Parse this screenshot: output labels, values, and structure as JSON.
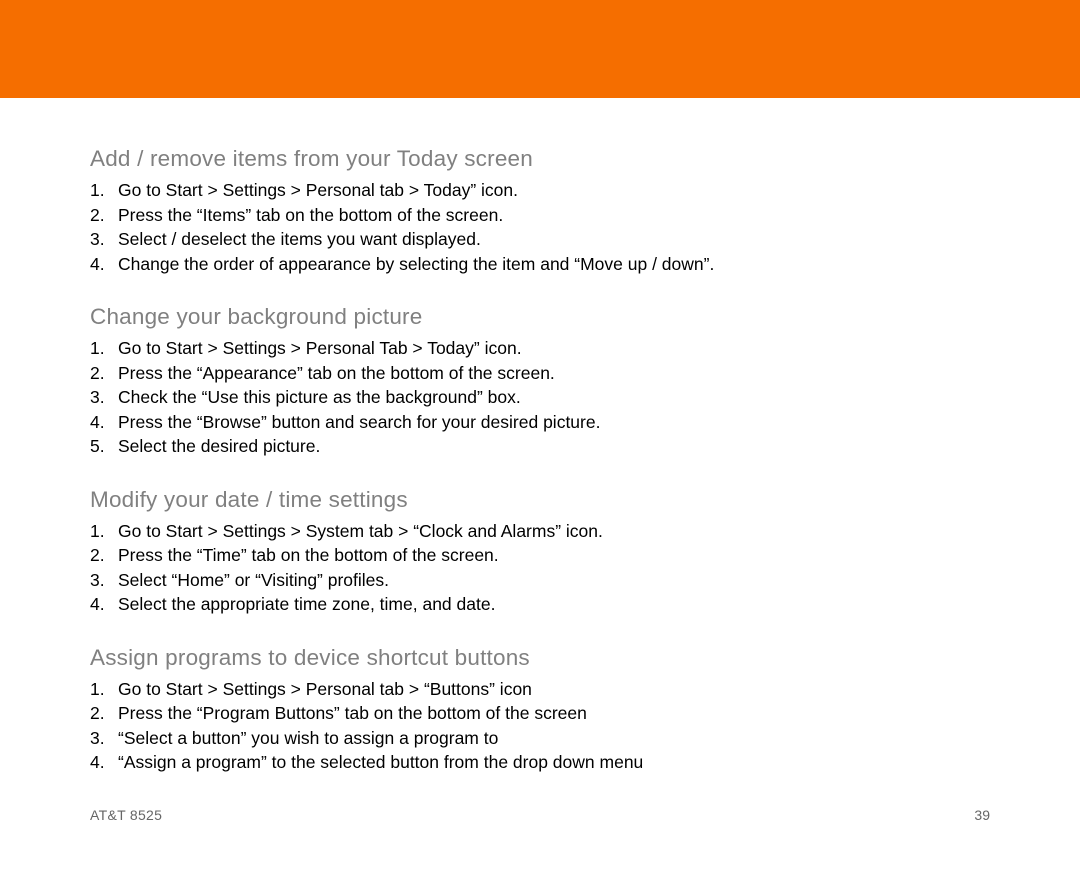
{
  "header": {
    "color": "#f56e00"
  },
  "sections": [
    {
      "title": "Add / remove items from your Today screen",
      "steps": [
        "Go to Start > Settings > Personal tab > Today” icon.",
        "Press the “Items” tab on the bottom of the screen.",
        "Select / deselect the items you want displayed.",
        "Change the order of appearance by selecting the item and “Move up / down”."
      ]
    },
    {
      "title": "Change your background picture",
      "steps": [
        "Go to Start > Settings > Personal Tab > Today” icon.",
        "Press the “Appearance” tab on the bottom of the screen.",
        "Check the “Use this picture as the background” box.",
        "Press the “Browse” button and search for your desired picture.",
        "Select the desired picture."
      ]
    },
    {
      "title": "Modify your date / time settings",
      "steps": [
        "Go to Start > Settings > System tab > “Clock and Alarms” icon.",
        "Press the “Time” tab on the bottom of the screen.",
        "Select “Home” or “Visiting” profiles.",
        "Select the appropriate time zone, time, and date."
      ]
    },
    {
      "title": "Assign programs to device shortcut buttons",
      "steps": [
        "Go to Start > Settings > Personal tab > “Buttons” icon",
        "Press the “Program Buttons” tab on the bottom of the screen",
        "“Select a button” you wish to assign a program to",
        "“Assign a program” to the selected button from the drop down menu"
      ]
    }
  ],
  "footer": {
    "model": "AT&T 8525",
    "page_number": "39"
  }
}
